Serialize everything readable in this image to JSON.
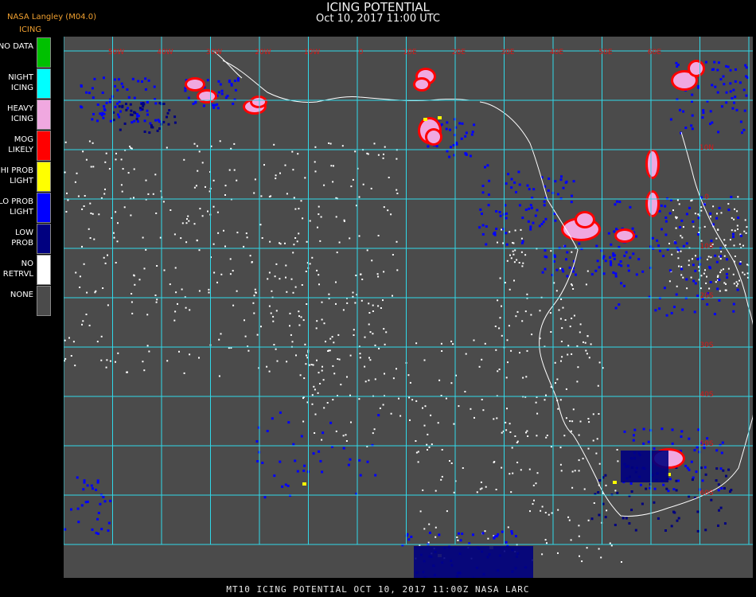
{
  "header": {
    "title": "ICING POTENTIAL",
    "subtitle": "Oct 10, 2017 11:00 UTC",
    "producer": "NASA Langley (M04.0)",
    "product": "ICING"
  },
  "legend": [
    {
      "label": "NO DATA",
      "color": "#00c000"
    },
    {
      "label": "NIGHT\nICING",
      "color": "#00ffff"
    },
    {
      "label": "HEAVY\nICING",
      "color": "#f0a8e0"
    },
    {
      "label": "MOG\nLIKELY",
      "color": "#ff0000"
    },
    {
      "label": "HI PROB\nLIGHT",
      "color": "#ffff00"
    },
    {
      "label": "LO PROB\nLIGHT",
      "color": "#0000ff"
    },
    {
      "label": "LOW\nPROB",
      "color": "#000080"
    },
    {
      "label": "NO\nRETRVL",
      "color": "#ffffff"
    },
    {
      "label": "NONE",
      "color": "#4b4b4b"
    }
  ],
  "colors": {
    "background": "#4b4b4b",
    "grid": "#30d8e8",
    "coastline": "#ffffff",
    "axis_labels": "#d81818"
  },
  "grid_labels": {
    "longitude": [
      "50W",
      "40W",
      "30W",
      "20W",
      "10W",
      "0",
      "10E",
      "20E",
      "30E",
      "40E",
      "50E",
      "60E"
    ],
    "latitude": [
      "10N",
      "0",
      "10S",
      "20S",
      "30S",
      "40S",
      "50S",
      "60S"
    ]
  },
  "footer": "MT10  ICING POTENTIAL   OCT 10, 2017 11:00Z   NASA LARC"
}
